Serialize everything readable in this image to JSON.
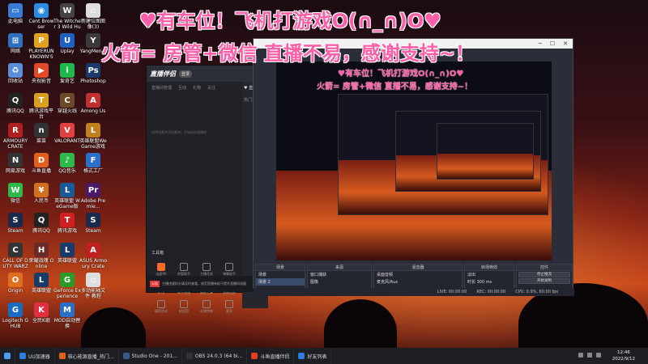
{
  "overlay": {
    "line1": "♥有车位！飞机打游戏O(∩_∩)O♥",
    "line2": "火箭= 房管+微信 直播不易，感谢支持~！"
  },
  "desktop_icons": [
    {
      "label": "此电脑",
      "color": "#3a7bd5",
      "glyph": "▭"
    },
    {
      "label": "Cent Browser",
      "color": "#2b8be0",
      "glyph": "◉"
    },
    {
      "label": "The Witcher 3 Wild Hunt",
      "color": "#444",
      "glyph": "W"
    },
    {
      "label": "新建位图图像(3)",
      "color": "#ddd",
      "glyph": "▫"
    },
    {
      "label": "网络",
      "color": "#2e6fc0",
      "glyph": "⊞"
    },
    {
      "label": "PLAYERUNKNOWN'S BATTLEGR...",
      "color": "#e0a020",
      "glyph": "P"
    },
    {
      "label": "Uplay",
      "color": "#2060c0",
      "glyph": "U"
    },
    {
      "label": "YangMen...",
      "color": "#3a3a3a",
      "glyph": "Y"
    },
    {
      "label": "回收站",
      "color": "#5a8fd8",
      "glyph": "♻"
    },
    {
      "label": "央视影音",
      "color": "#e04a2a",
      "glyph": "▶"
    },
    {
      "label": "爱奇艺",
      "color": "#1fb84a",
      "glyph": "i"
    },
    {
      "label": "Photoshop",
      "color": "#1a3a6a",
      "glyph": "Ps"
    },
    {
      "label": "腾讯QQ",
      "color": "#222",
      "glyph": "Q"
    },
    {
      "label": "腾讯游戏平台",
      "color": "#d8a020",
      "glyph": "T"
    },
    {
      "label": "穿越火线",
      "color": "#6a4a2a",
      "glyph": "C"
    },
    {
      "label": "Among Us",
      "color": "#c03030",
      "glyph": "A"
    },
    {
      "label": "ARMOURY CRATE",
      "color": "#b02020",
      "glyph": "R"
    },
    {
      "label": "菜苗",
      "color": "#333",
      "glyph": "n"
    },
    {
      "label": "VALORANT",
      "color": "#e04040",
      "glyph": "V"
    },
    {
      "label": "英雄联盟WeGame游戏(LMA)",
      "color": "#c08020",
      "glyph": "L"
    },
    {
      "label": "网易游戏",
      "color": "#333",
      "glyph": "N"
    },
    {
      "label": "斗鱼直播",
      "color": "#e06020",
      "glyph": "D"
    },
    {
      "label": "QQ音乐",
      "color": "#2fb84a",
      "glyph": "♪"
    },
    {
      "label": "格式工厂",
      "color": "#2a70c8",
      "glyph": "F"
    },
    {
      "label": "微信",
      "color": "#2fb84a",
      "glyph": "W"
    },
    {
      "label": "人民币",
      "color": "#d07020",
      "glyph": "¥"
    },
    {
      "label": "英雄联盟 WeGame版",
      "color": "#1a5a9a",
      "glyph": "L"
    },
    {
      "label": "Adobe Premie...",
      "color": "#4a1a6a",
      "glyph": "Pr"
    },
    {
      "label": "Steam",
      "color": "#1a2a4a",
      "glyph": "S"
    },
    {
      "label": "腾讯QQ",
      "color": "#222",
      "glyph": "Q"
    },
    {
      "label": "腾讯游戏",
      "color": "#d02020",
      "glyph": "T"
    },
    {
      "label": "Steam",
      "color": "#1a2a4a",
      "glyph": "S"
    },
    {
      "label": "CALL OF DUTY WARZONE",
      "color": "#333",
      "glyph": "C"
    },
    {
      "label": "荣耀战魂 Online",
      "color": "#6a2a2a",
      "glyph": "H"
    },
    {
      "label": "英雄联盟",
      "color": "#1a3a6a",
      "glyph": "L"
    },
    {
      "label": "ASUS Armoury Crate",
      "color": "#c02020",
      "glyph": "A"
    },
    {
      "label": "Origin",
      "color": "#e07020",
      "glyph": "O"
    },
    {
      "label": "英雄联盟",
      "color": "#1a3a6a",
      "glyph": "L"
    },
    {
      "label": "GeForce Experience",
      "color": "#2a9a2a",
      "glyph": "G"
    },
    {
      "label": "多动能轴文件 教程",
      "color": "#ddd",
      "glyph": "▫"
    },
    {
      "label": "Logitech G HUB",
      "color": "#1a6ac0",
      "glyph": "G"
    },
    {
      "label": "全民K歌",
      "color": "#e03040",
      "glyph": "K"
    },
    {
      "label": "MOD自动替换",
      "color": "#2a70c8",
      "glyph": "M"
    }
  ],
  "companion": {
    "logo": "直播伴侣",
    "badge": "登录",
    "tabs": [
      "直播间管理",
      "互动",
      "礼物",
      "关注"
    ],
    "hint": "选择场景并添加素材，开始你的直播吧",
    "right_title": "♥ 直播成",
    "right_sub": "热门直播",
    "tools_title": "工具箱",
    "tools": [
      "连麦PK",
      "房管助手",
      "主播任务",
      "弹幕助手",
      "红包",
      "录入直播",
      "截图工具",
      "直播回放",
      "福利活动",
      "粉丝团",
      "礼物特效",
      "更多"
    ],
    "footer_tag": "公告",
    "footer": "主播违规扣分请及时查看，规范直播有助于提升直播间流量"
  },
  "obs": {
    "docks": {
      "scenes_title": "场景",
      "scenes": [
        "场景",
        "场景 2"
      ],
      "sources_title": "来源",
      "sources": [
        "窗口捕获",
        "图像",
        "11111",
        "图像 2",
        "1"
      ],
      "mixer_title": "混音器",
      "mixer": [
        "桌面音频",
        "麦克风/Aux"
      ],
      "transition_title": "转场特效",
      "transition_value": "淡出",
      "transition_duration_label": "时长",
      "transition_duration": "300 ms",
      "controls_title": "控件",
      "controls": [
        "停止推流",
        "开始录制",
        "工作室模式",
        "设置",
        "退出"
      ]
    },
    "status": {
      "live": "LIVE: 00:00:00",
      "rec": "REC: 00:00:00",
      "cpu": "CPU: 0.9%, 60.00 fps"
    }
  },
  "taskbar": {
    "items": [
      {
        "label": "UU加速器",
        "color": "#2a7ae0"
      },
      {
        "label": "核心能源直播_热门...",
        "color": "#e06020"
      },
      {
        "label": "Studio One - 201...",
        "color": "#3a5a8a"
      },
      {
        "label": "OBS 24.0.3 (64 bi...",
        "color": "#333"
      },
      {
        "label": "斗鱼直播伴侣",
        "color": "#e04020"
      },
      {
        "label": "好友列表",
        "color": "#2a7ae0"
      }
    ],
    "time": "12:46",
    "date": "2022/9/12"
  }
}
